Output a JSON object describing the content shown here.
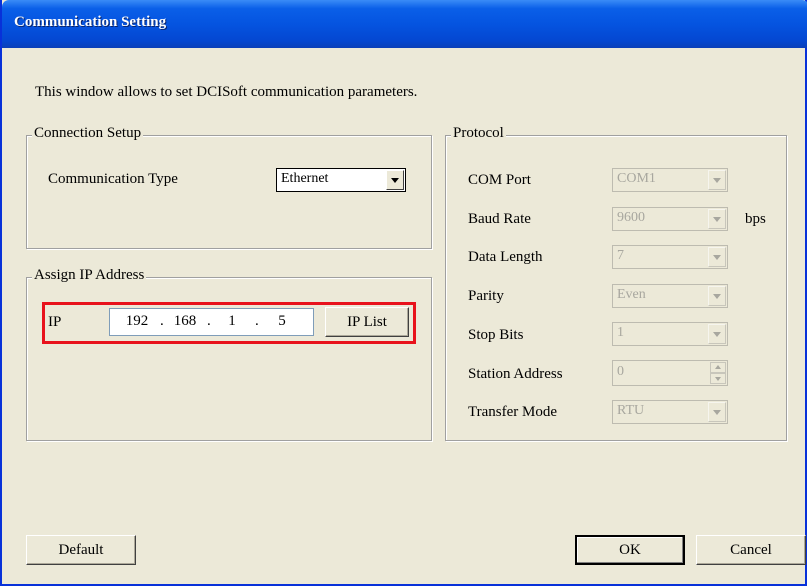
{
  "window": {
    "title": "Communication Setting"
  },
  "description": "This window allows to set  DCISoft communication parameters.",
  "connection_setup": {
    "legend": "Connection Setup",
    "comm_type_label": "Communication Type",
    "comm_type_value": "Ethernet"
  },
  "assign_ip": {
    "legend": "Assign IP Address",
    "ip_label": "IP",
    "octets": [
      "192",
      "168",
      "1",
      "5"
    ],
    "ip_list_label": "IP List"
  },
  "protocol": {
    "legend": "Protocol",
    "com_port": {
      "label": "COM Port",
      "value": "COM1"
    },
    "baud_rate": {
      "label": "Baud Rate",
      "value": "9600",
      "unit": "bps"
    },
    "data_length": {
      "label": "Data Length",
      "value": "7"
    },
    "parity": {
      "label": "Parity",
      "value": "Even"
    },
    "stop_bits": {
      "label": "Stop Bits",
      "value": "1"
    },
    "station_address": {
      "label": "Station Address",
      "value": "0"
    },
    "transfer_mode": {
      "label": "Transfer Mode",
      "value": "RTU"
    }
  },
  "buttons": {
    "default": "Default",
    "ok": "OK",
    "cancel": "Cancel"
  },
  "colors": {
    "title_bar": "#0554e0",
    "dialog_bg": "#ece9d8",
    "highlight": "#e8121c"
  }
}
